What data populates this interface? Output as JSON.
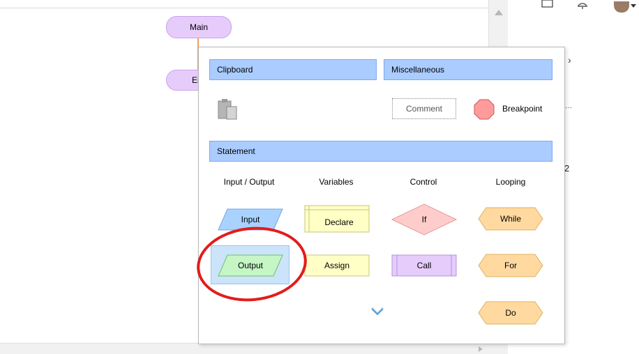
{
  "canvas": {
    "nodes": {
      "main": "Main",
      "end": "Er"
    }
  },
  "right_panel": {
    "number": "2",
    "dots": "···",
    "chevron": "›"
  },
  "popup": {
    "sections": {
      "clipboard": "Clipboard",
      "misc": "Miscellaneous",
      "statement": "Statement"
    },
    "misc_items": {
      "comment": "Comment",
      "breakpoint": "Breakpoint"
    },
    "columns": [
      "Input / Output",
      "Variables",
      "Control",
      "Looping"
    ],
    "shapes": {
      "input": "Input",
      "output": "Output",
      "declare": "Declare",
      "assign": "Assign",
      "if": "If",
      "call": "Call",
      "while": "While",
      "for": "For",
      "do": "Do"
    }
  },
  "colors": {
    "section_bar": "#aaccff",
    "io_fill": "#a9d2ff",
    "output_fill": "#c6f5c6",
    "var_fill": "#ffffc6",
    "if_fill": "#ffcccc",
    "call_fill": "#e6ccfb",
    "loop_fill": "#ffd9a0",
    "selection": "#cce4fa",
    "highlight_ring": "#e21c1c"
  },
  "icons": [
    "clipboard-paste-icon",
    "breakpoint-octagon-icon",
    "scroll-down-chevron-icon",
    "expand-right-icon",
    "window-icon",
    "bell-icon",
    "avatar"
  ]
}
